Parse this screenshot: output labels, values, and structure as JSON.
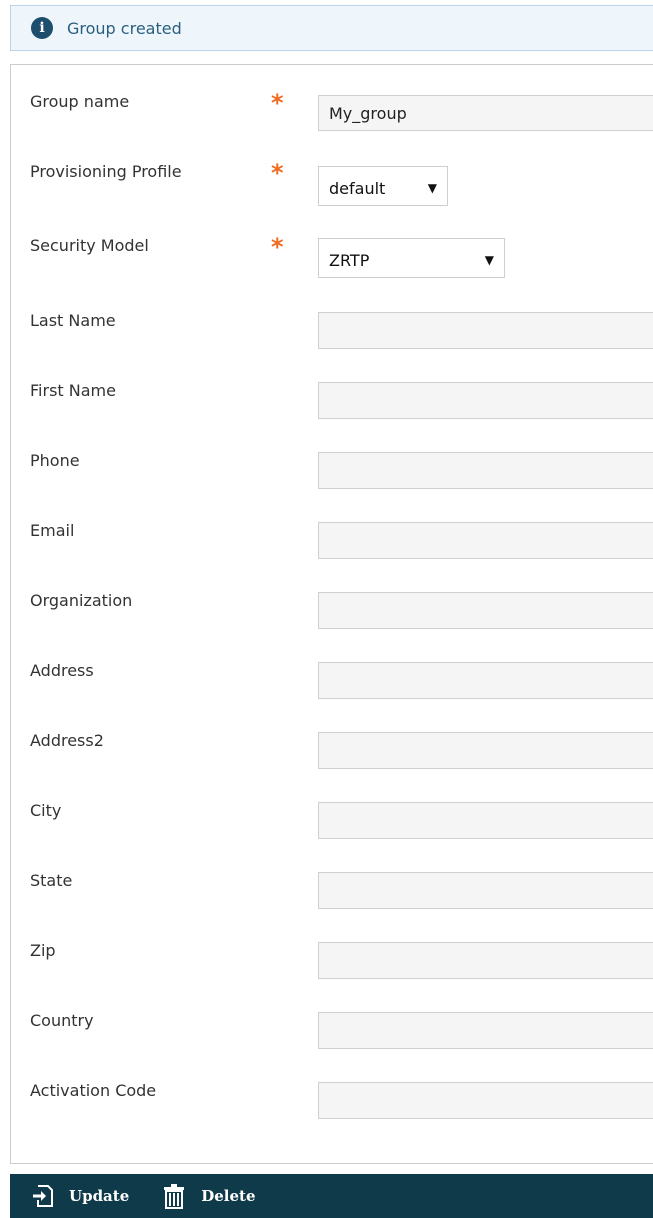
{
  "notice": {
    "text": "Group created",
    "icon": "info-icon"
  },
  "form": {
    "group_name": {
      "label": "Group name",
      "value": "My_group",
      "required": "*"
    },
    "provisioning_profile": {
      "label": "Provisioning Profile",
      "value": "default",
      "required": "*",
      "arrow": "▼"
    },
    "security_model": {
      "label": "Security Model",
      "value": "ZRTP",
      "required": "*",
      "arrow": "▼"
    },
    "last_name": {
      "label": "Last Name",
      "value": ""
    },
    "first_name": {
      "label": "First Name",
      "value": ""
    },
    "phone": {
      "label": "Phone",
      "value": ""
    },
    "email": {
      "label": "Email",
      "value": ""
    },
    "organization": {
      "label": "Organization",
      "value": ""
    },
    "address": {
      "label": "Address",
      "value": ""
    },
    "address2": {
      "label": "Address2",
      "value": ""
    },
    "city": {
      "label": "City",
      "value": ""
    },
    "state": {
      "label": "State",
      "value": ""
    },
    "zip": {
      "label": "Zip",
      "value": ""
    },
    "country": {
      "label": "Country",
      "value": ""
    },
    "activation_code": {
      "label": "Activation Code",
      "value": ""
    }
  },
  "footer": {
    "update_label": "Update",
    "delete_label": "Delete"
  },
  "colors": {
    "accent_required": "#ef6b1f",
    "footer_bg": "#0f3a4a",
    "notice_bg": "#eef6fc"
  }
}
